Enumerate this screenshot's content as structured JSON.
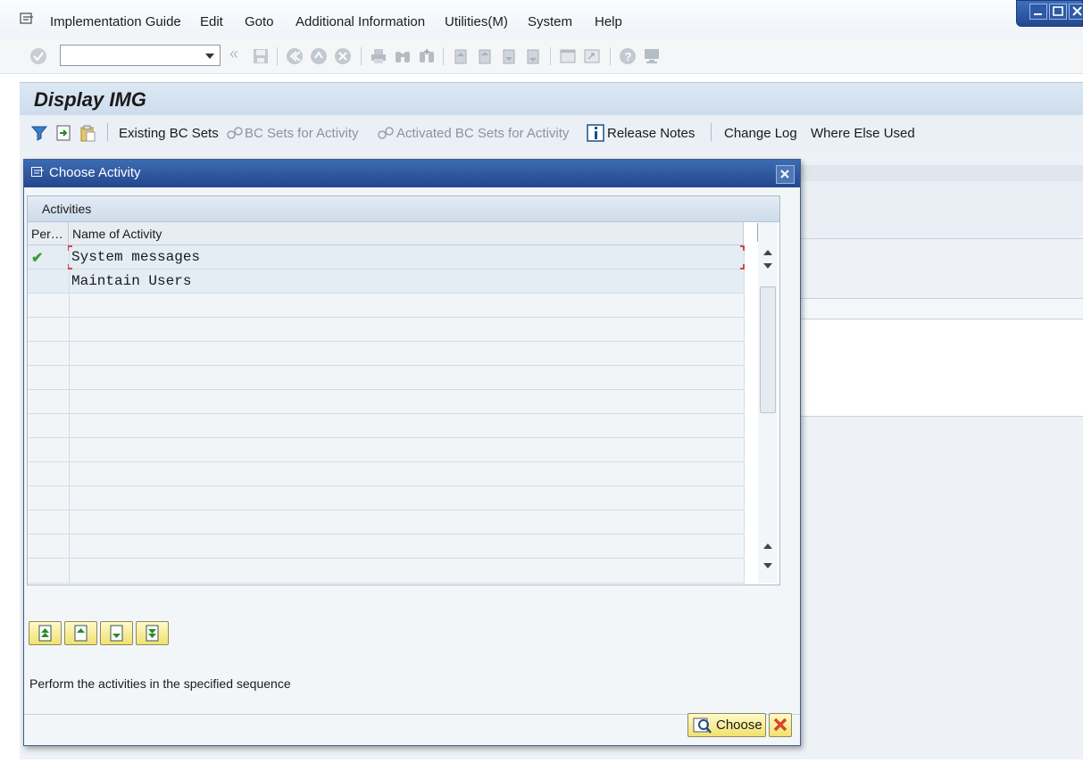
{
  "menubar": {
    "items": [
      {
        "label": "Implementation Guide",
        "key": "I"
      },
      {
        "label": "Edit",
        "key": "E"
      },
      {
        "label": "Goto",
        "key": "G"
      },
      {
        "label": "Additional Information",
        "key": "A"
      },
      {
        "label": "Utilities(M)",
        "key": "M"
      },
      {
        "label": "System",
        "key": "y"
      },
      {
        "label": "Help",
        "key": "H"
      }
    ]
  },
  "toolbar": {
    "command_field_value": "",
    "icons": [
      "enter-icon",
      "save-icon",
      "back-icon",
      "exit-icon",
      "cancel-icon",
      "print-icon",
      "find-icon",
      "find-next-icon",
      "first-page-icon",
      "previous-page-icon",
      "next-page-icon",
      "last-page-icon",
      "create-session-icon",
      "shortcut-icon",
      "help-icon",
      "customize-layout-icon"
    ]
  },
  "screen": {
    "title": "Display IMG",
    "app_toolbar": {
      "existing_bc_sets": "Existing BC Sets",
      "bc_sets_for_activity": "BC Sets for Activity",
      "activated_bc_sets": "Activated BC Sets for Activity",
      "release_notes": "Release Notes",
      "change_log": "Change Log",
      "where_else_used": "Where Else Used"
    }
  },
  "dialog": {
    "title": "Choose Activity",
    "panel_title": "Activities",
    "columns": {
      "performed": "Per…",
      "name": "Name of Activity"
    },
    "rows": [
      {
        "performed": true,
        "name": "System messages"
      },
      {
        "performed": false,
        "name": "Maintain Users"
      }
    ],
    "status_text": "Perform the activities in the specified sequence",
    "choose_label": "Choose",
    "colors": {
      "header": "#2c56a0",
      "button_yellow": "#f6e88a",
      "check_green": "#3f9c2a",
      "cancel_red": "#d6462a"
    }
  }
}
